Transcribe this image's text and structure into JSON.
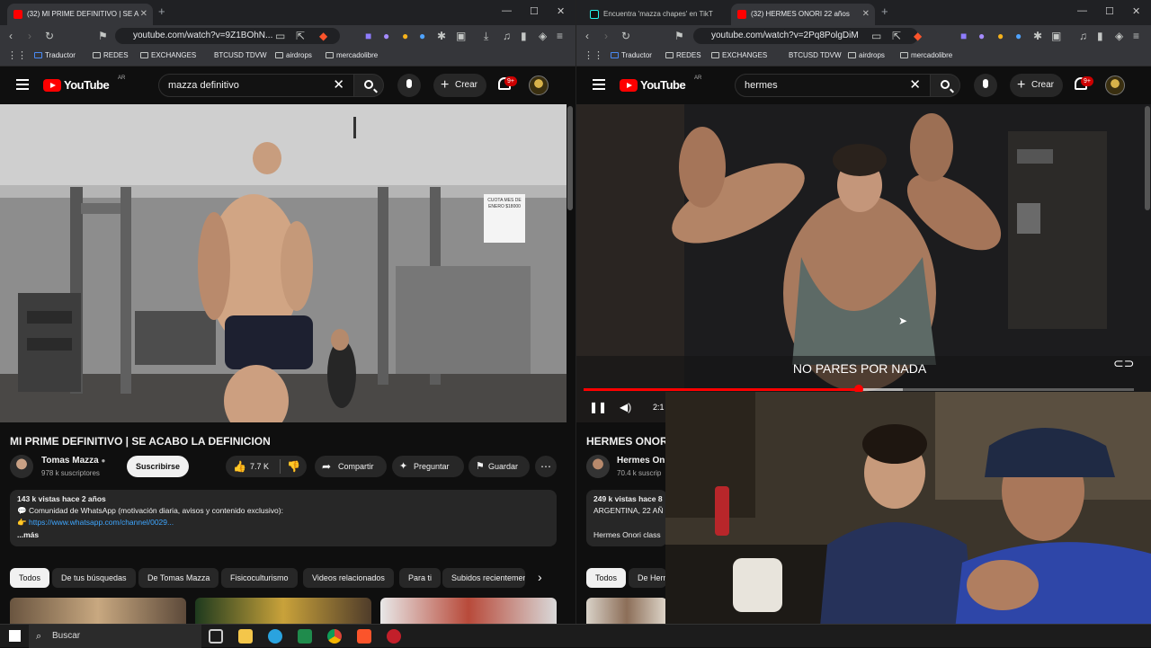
{
  "left_window": {
    "tabs": [
      {
        "title": "(32) MI PRIME DEFINITIVO | SE A",
        "active": true
      }
    ],
    "url": "youtube.com/watch?v=9Z1BOhN...",
    "bookmarks": [
      "Traductor",
      "REDES",
      "EXCHANGES",
      "BTCUSD TDVW",
      "airdrops",
      "mercadolibre"
    ],
    "youtube": {
      "logo": "YouTube",
      "country": "AR",
      "search_value": "mazza definitivo",
      "create_label": "Crear",
      "notifications": "9+"
    },
    "video": {
      "title": "MI PRIME DEFINITIVO | SE ACABO LA DEFINICION",
      "channel": "Tomas Mazza",
      "subscribers": "978 k suscriptores",
      "subscribe_label": "Suscribirse",
      "likes": "7.7 K",
      "share_label": "Compartir",
      "ask_label": "Preguntar",
      "save_label": "Guardar",
      "wall_note": "CUOTA MES DE ENERO $18000",
      "description": {
        "stats": "143 k vistas  hace 2 años",
        "line1": "Comunidad de WhatsApp (motivación diaria, avisos y contenido exclusivo):",
        "link": "https://www.whatsapp.com/channel/0029...",
        "more": "...más"
      }
    },
    "chips": [
      "Todos",
      "De tus búsquedas",
      "De Tomas Mazza",
      "Fisicoculturismo",
      "Videos relacionados",
      "Para ti",
      "Subidos recientemente"
    ]
  },
  "right_window": {
    "tabs": [
      {
        "title": "Encuentra 'mazza chapes' en TikT",
        "active": false
      },
      {
        "title": "(32) HERMES ONORI 22 años",
        "active": true
      }
    ],
    "url": "youtube.com/watch?v=2Pq8PolgDiM",
    "bookmarks": [
      "Traductor",
      "REDES",
      "EXCHANGES",
      "BTCUSD TDVW",
      "airdrops",
      "mercadolibre"
    ],
    "youtube": {
      "logo": "YouTube",
      "country": "AR",
      "search_value": "hermes",
      "create_label": "Crear",
      "notifications": "9+"
    },
    "video": {
      "caption": "NO PARES POR NADA",
      "time": "2:1",
      "progress_percent": 50,
      "title": "HERMES ONOR",
      "channel": "Hermes On",
      "subscribers": "70.4 k suscrip",
      "description": {
        "stats": "249 k vistas  hace 8",
        "line1": "ARGENTINA, 22 AÑ",
        "line2": "Hermes Onori class"
      }
    },
    "chips": [
      "Todos",
      "De Herm"
    ]
  },
  "taskbar": {
    "search_placeholder": "Buscar"
  },
  "colors": {
    "background": "#0f0f0f",
    "youtube_red": "#ff0000",
    "chip_selected": "#f1f1f1",
    "link": "#3ea6ff"
  }
}
